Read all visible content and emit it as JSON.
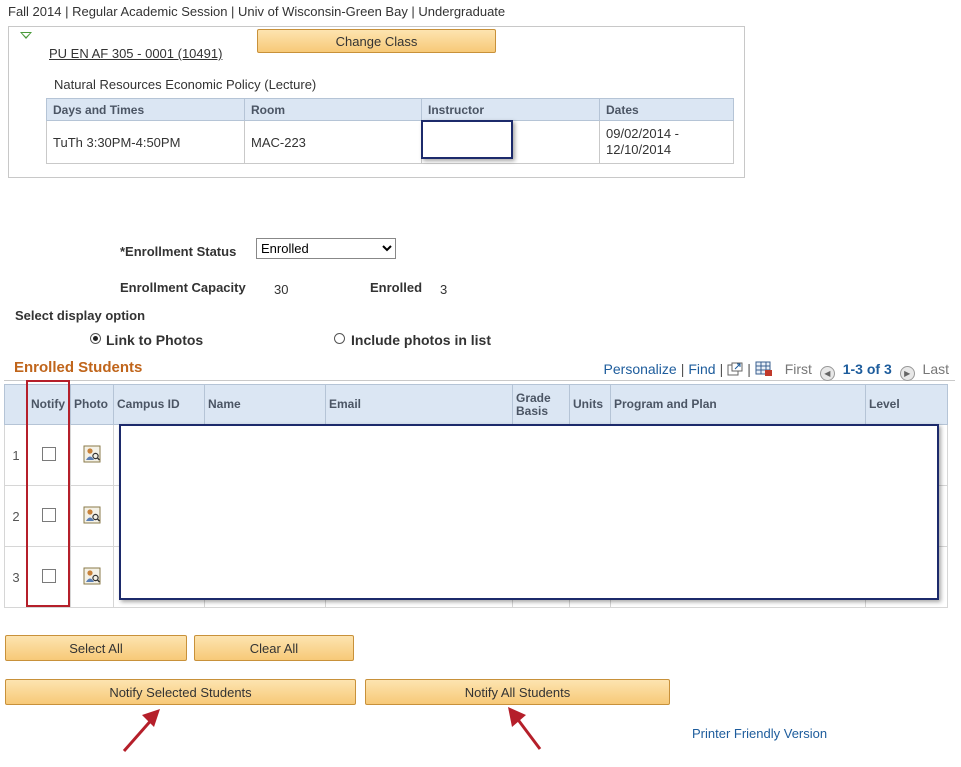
{
  "header": {
    "term_line": "Fall 2014 | Regular Academic Session | Univ of Wisconsin-Green Bay | Undergraduate"
  },
  "class_info": {
    "class_link": "PU EN AF 305 - 0001 (10491)",
    "change_class_label": "Change Class",
    "description": "Natural Resources Economic Policy (Lecture)",
    "meeting_table": {
      "headers": [
        "Days and Times",
        "Room",
        "Instructor",
        "Dates"
      ],
      "row": {
        "days_times": "TuTh 3:30PM-4:50PM",
        "room": "MAC-223",
        "instructor": "",
        "dates_line1": "09/02/2014 -",
        "dates_line2": "12/10/2014"
      }
    }
  },
  "enrollment": {
    "status_label": "*Enrollment Status",
    "status_value": "Enrolled",
    "capacity_label": "Enrollment Capacity",
    "capacity_value": "30",
    "enrolled_label": "Enrolled",
    "enrolled_value": "3"
  },
  "display_option": {
    "heading": "Select display option",
    "link_to_photos": "Link to Photos",
    "include_photos": "Include photos in list",
    "selected": "link_to_photos"
  },
  "enrolled_students": {
    "title": "Enrolled Students",
    "personalize": "Personalize",
    "find": "Find",
    "first": "First",
    "range": "1-3 of 3",
    "last": "Last",
    "columns": {
      "notify": "Notify",
      "photo": "Photo",
      "campus_id": "Campus ID",
      "name": "Name",
      "email": "Email",
      "grade_basis_1": "Grade",
      "grade_basis_2": "Basis",
      "units": "Units",
      "program_plan": "Program and Plan",
      "level": "Level"
    },
    "rows": [
      {
        "num": "1"
      },
      {
        "num": "2"
      },
      {
        "num": "3"
      }
    ]
  },
  "actions": {
    "select_all": "Select All",
    "clear_all": "Clear All",
    "notify_selected": "Notify Selected Students",
    "notify_all": "Notify All Students",
    "printer_friendly": "Printer Friendly Version"
  },
  "colors": {
    "accent_header": "#dbe6f3",
    "grid_title": "#c0651b",
    "link": "#1d5c9c",
    "button": "#f7c978",
    "highlight_box": "#b51f2a",
    "mask_border": "#1c2a6b"
  },
  "icons": {
    "expand": "triangle-down-icon",
    "photo": "student-photo-icon",
    "view_all": "view-all-icon",
    "download": "download-excel-icon",
    "prev": "prev-arrow-icon",
    "next": "next-arrow-icon"
  }
}
